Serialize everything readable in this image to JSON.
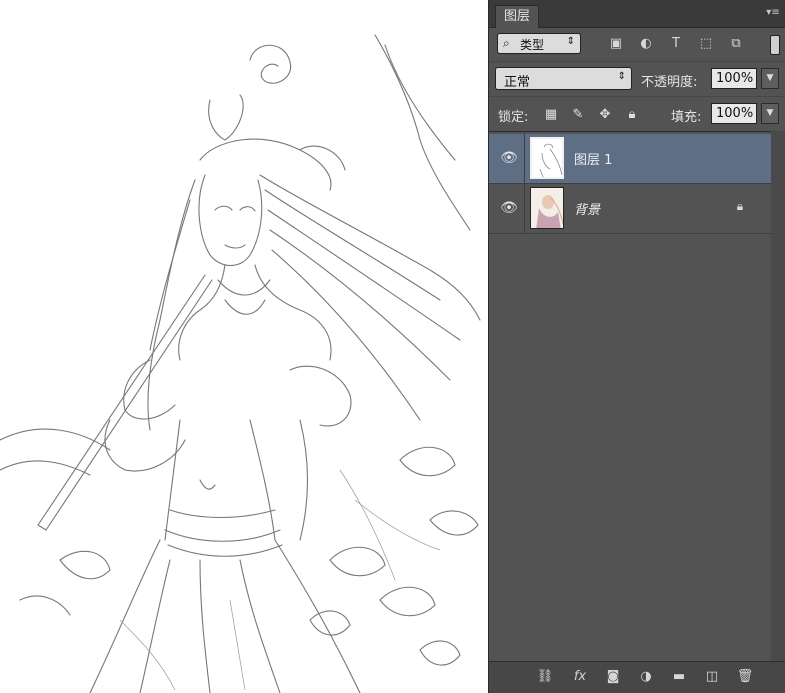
{
  "panel": {
    "tab_label": "图层",
    "menu_icon": "panel-menu-icon"
  },
  "filter": {
    "kind_label": "类型",
    "search_icon": "search-icon",
    "filter_icons": [
      "image-filter-icon",
      "adjustment-filter-icon",
      "type-filter-icon",
      "shape-filter-icon",
      "smart-object-filter-icon"
    ]
  },
  "blend": {
    "mode": "正常",
    "opacity_label": "不透明度:",
    "opacity_value": "100%"
  },
  "lock": {
    "label": "锁定:",
    "fill_label": "填充:",
    "fill_value": "100%",
    "icons": [
      "lock-transparent-icon",
      "lock-paint-icon",
      "lock-position-icon",
      "lock-all-icon"
    ]
  },
  "layers": [
    {
      "name": "图层 1",
      "selected": true,
      "visible": true,
      "locked": false
    },
    {
      "name": "背景",
      "selected": false,
      "visible": true,
      "locked": true
    }
  ],
  "bottom_icons": [
    "link-layers-icon",
    "fx-icon",
    "add-mask-icon",
    "adjustment-layer-icon",
    "new-group-icon",
    "new-layer-icon",
    "delete-layer-icon"
  ],
  "colors": {
    "panel_bg": "#535353",
    "selected_layer": "#5e6f85",
    "canvas": "#ffffff"
  }
}
